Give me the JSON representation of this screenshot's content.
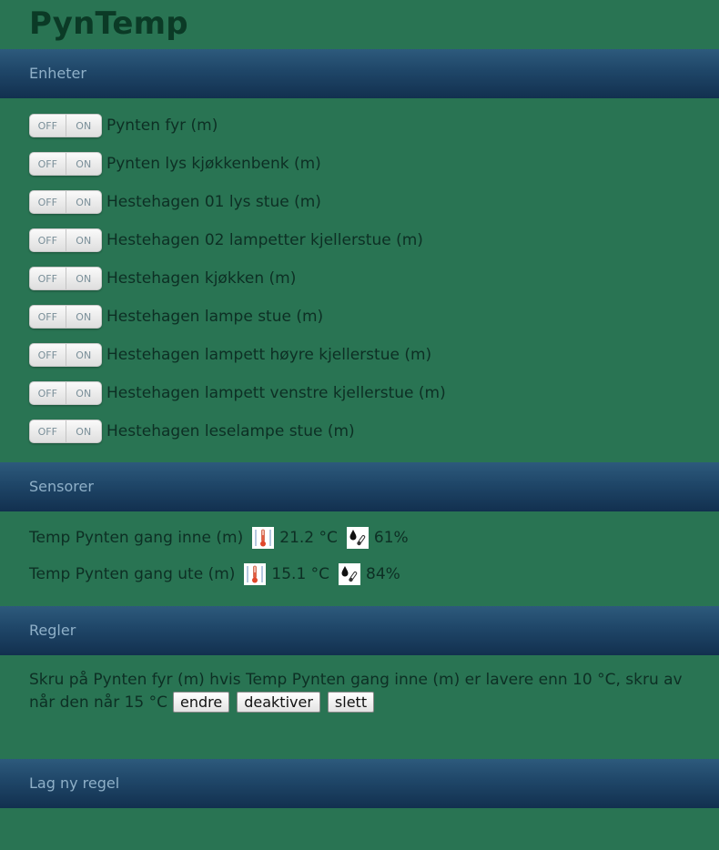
{
  "app": {
    "title": "PynTemp"
  },
  "sections": {
    "devices": "Enheter",
    "sensors": "Sensorer",
    "rules": "Regler",
    "new_rule": "Lag ny regel"
  },
  "toggle": {
    "off_label": "OFF",
    "on_label": "ON"
  },
  "devices": [
    "Pynten fyr (m)",
    "Pynten lys kjøkkenbenk (m)",
    "Hestehagen 01 lys stue (m)",
    "Hestehagen 02 lampetter kjellerstue (m)",
    "Hestehagen kjøkken (m)",
    "Hestehagen lampe stue (m)",
    "Hestehagen lampett høyre kjellerstue (m)",
    "Hestehagen lampett venstre kjellerstue (m)",
    "Hestehagen leselampe stue (m)"
  ],
  "sensors": [
    {
      "name": "Temp Pynten gang inne (m)",
      "temperature": "21.2 °C",
      "humidity": "61%",
      "temp_icon": "thermometer-icon",
      "humidity_icon": "humidity-icon"
    },
    {
      "name": "Temp Pynten gang ute (m)",
      "temperature": "15.1 °C",
      "humidity": "84%",
      "temp_icon": "thermometer-icon",
      "humidity_icon": "humidity-icon"
    }
  ],
  "rules": [
    {
      "text": "Skru på Pynten fyr (m) hvis Temp Pynten gang inne (m) er lavere enn 10 °C, skru av når den når 15 °C",
      "edit_label": "endre",
      "deactivate_label": "deaktiver",
      "delete_label": "slett"
    }
  ],
  "colors": {
    "page_background": "#297453",
    "header_gradient_top": "#2d5a7c",
    "header_gradient_bottom": "#12304f",
    "header_text": "#8fb0c8",
    "title_text": "#0b3a26"
  }
}
